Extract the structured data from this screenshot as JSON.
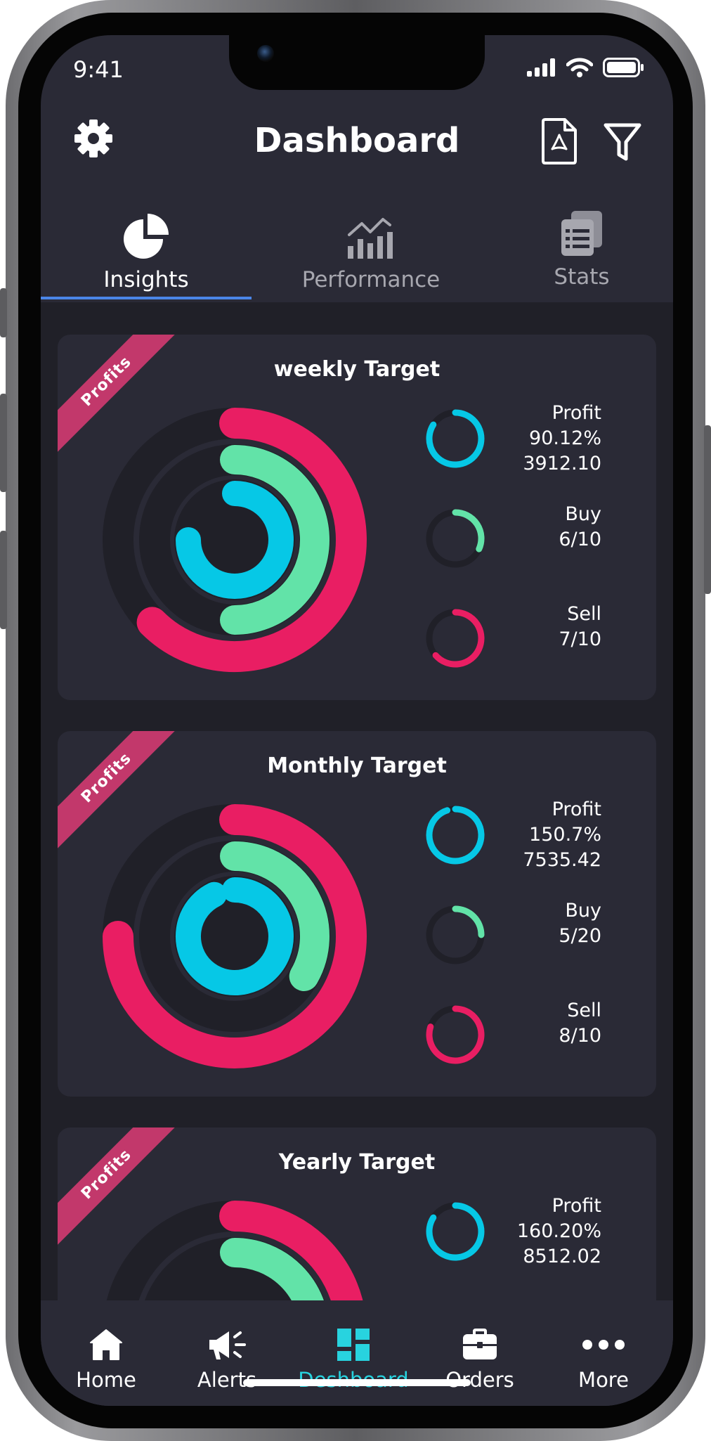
{
  "status_bar": {
    "time": "9:41"
  },
  "header": {
    "title": "Dashboard"
  },
  "tabs": [
    {
      "label": "Insights",
      "active": true
    },
    {
      "label": "Performance",
      "active": false
    },
    {
      "label": "Stats",
      "active": false
    }
  ],
  "cards": [
    {
      "ribbon": "Profits",
      "title": "weekly Target",
      "profit_label": "Profit",
      "profit_pct": "90.12%",
      "profit_value": "3912.10",
      "buy_label": "Buy",
      "buy_value": "6/10",
      "sell_label": "Sell",
      "sell_value": "7/10"
    },
    {
      "ribbon": "Profits",
      "title": "Monthly Target",
      "profit_label": "Profit",
      "profit_pct": "150.7%",
      "profit_value": "7535.42",
      "buy_label": "Buy",
      "buy_value": "5/20",
      "sell_label": "Sell",
      "sell_value": "8/10"
    },
    {
      "ribbon": "Profits",
      "title": "Yearly Target",
      "profit_label": "Profit",
      "profit_pct": "160.20%",
      "profit_value": "8512.02"
    }
  ],
  "bottom_nav": [
    {
      "label": "Home",
      "icon": "home-icon"
    },
    {
      "label": "Alerts",
      "icon": "megaphone-icon"
    },
    {
      "label": "Deshboard",
      "icon": "dashboard-icon",
      "active": true
    },
    {
      "label": "Orders",
      "icon": "briefcase-icon"
    },
    {
      "label": "More",
      "icon": "more-icon"
    }
  ],
  "colors": {
    "accent_cyan": "#06c8e6",
    "ring_green": "#62e3a8",
    "ring_pink": "#e91e63",
    "tab_active": "#4a86e8",
    "nav_active": "#28d3df"
  }
}
